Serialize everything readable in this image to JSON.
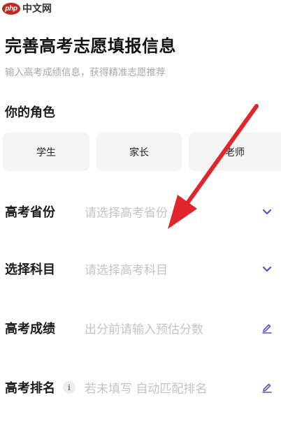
{
  "watermark": {
    "logo_text": "php",
    "site_text": "中文网"
  },
  "header": {
    "title": "完善高考志愿填报信息",
    "subtitle": "输入高考成绩信息，获得精准志愿推荐"
  },
  "role": {
    "label": "你的角色",
    "options": [
      "学生",
      "家长",
      "老师"
    ]
  },
  "form": {
    "province": {
      "label": "高考省份",
      "placeholder": "请选择高考省份"
    },
    "subject": {
      "label": "选择科目",
      "placeholder": "请选择高考科目"
    },
    "score": {
      "label": "高考成绩",
      "placeholder": "出分前请输入预估分数"
    },
    "rank": {
      "label": "高考排名",
      "info_icon": "i",
      "placeholder": "若未填写 自动匹配排名"
    }
  },
  "colors": {
    "accent": "#5b4fc4",
    "arrow": "#e0262b",
    "button_bg": "#f4f4f5",
    "placeholder": "#c4c4c4"
  },
  "icons": {
    "dropdown": "chevron-down-icon",
    "edit": "pencil-icon",
    "info": "info-icon",
    "annotation": "red-arrow"
  }
}
